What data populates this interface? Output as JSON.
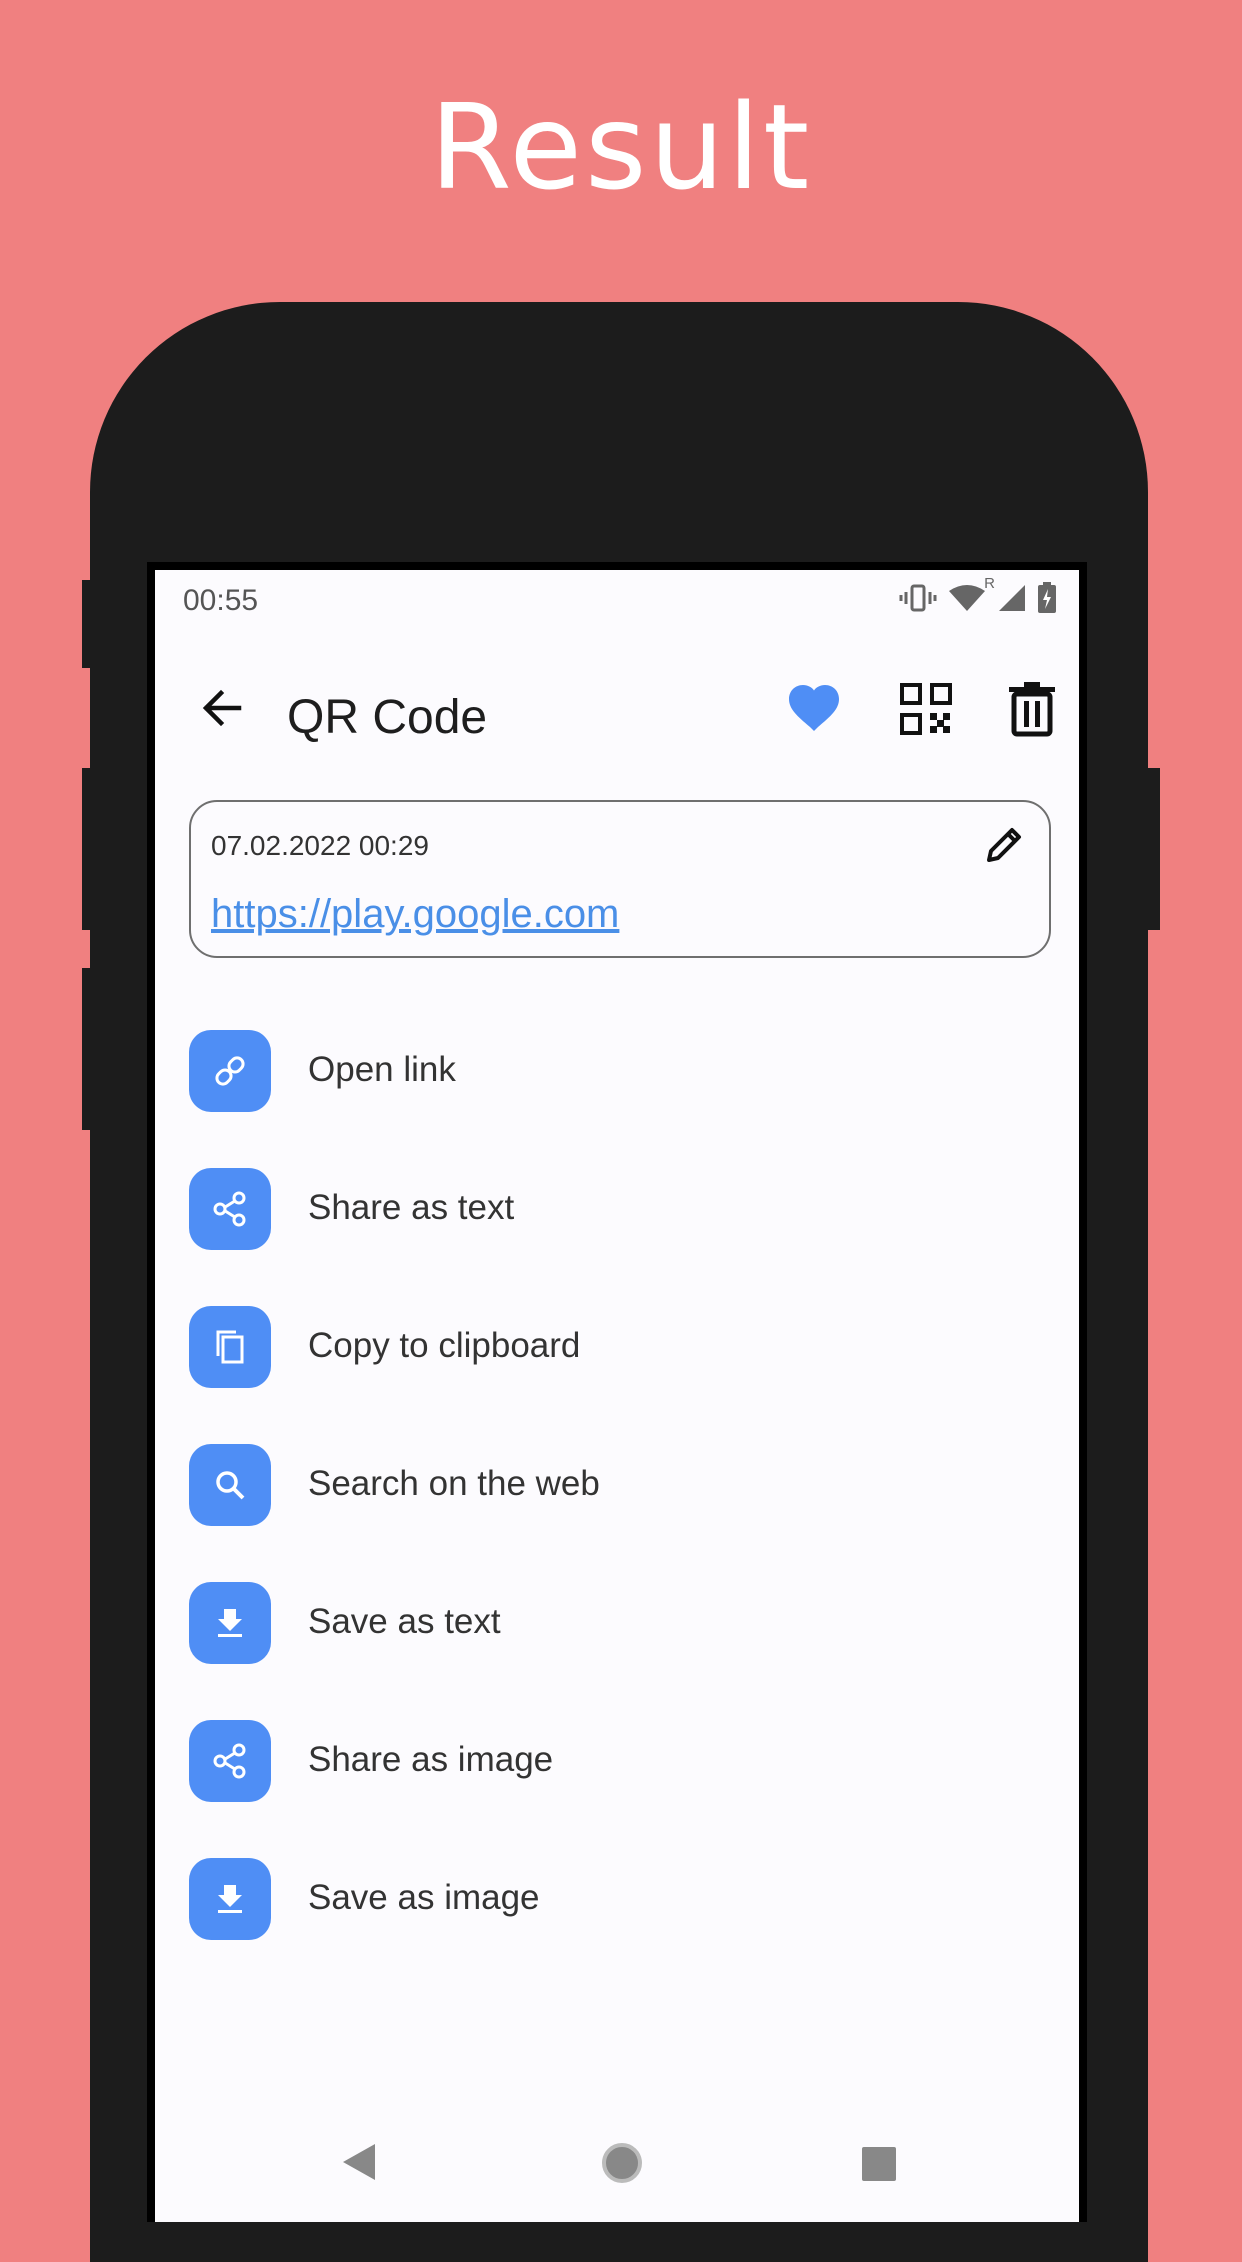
{
  "promo": {
    "title": "Result"
  },
  "status_bar": {
    "time": "00:55",
    "network_badge": "R"
  },
  "appbar": {
    "title": "QR Code"
  },
  "card": {
    "date": "07.02.2022 00:29",
    "link": "https://play.google.com"
  },
  "actions": [
    {
      "label": "Open link",
      "icon": "link-icon"
    },
    {
      "label": "Share as text",
      "icon": "share-icon"
    },
    {
      "label": "Copy to clipboard",
      "icon": "copy-icon"
    },
    {
      "label": "Search on the web",
      "icon": "search-icon"
    },
    {
      "label": "Save as text",
      "icon": "download-icon"
    },
    {
      "label": "Share as image",
      "icon": "share-icon"
    },
    {
      "label": "Save as image",
      "icon": "download-icon"
    }
  ],
  "colors": {
    "background": "#F08080",
    "accent": "#4F8EF5",
    "link": "#4A8FE7",
    "phone_frame": "#1C1C1C",
    "screen": "#FCFBFE"
  }
}
